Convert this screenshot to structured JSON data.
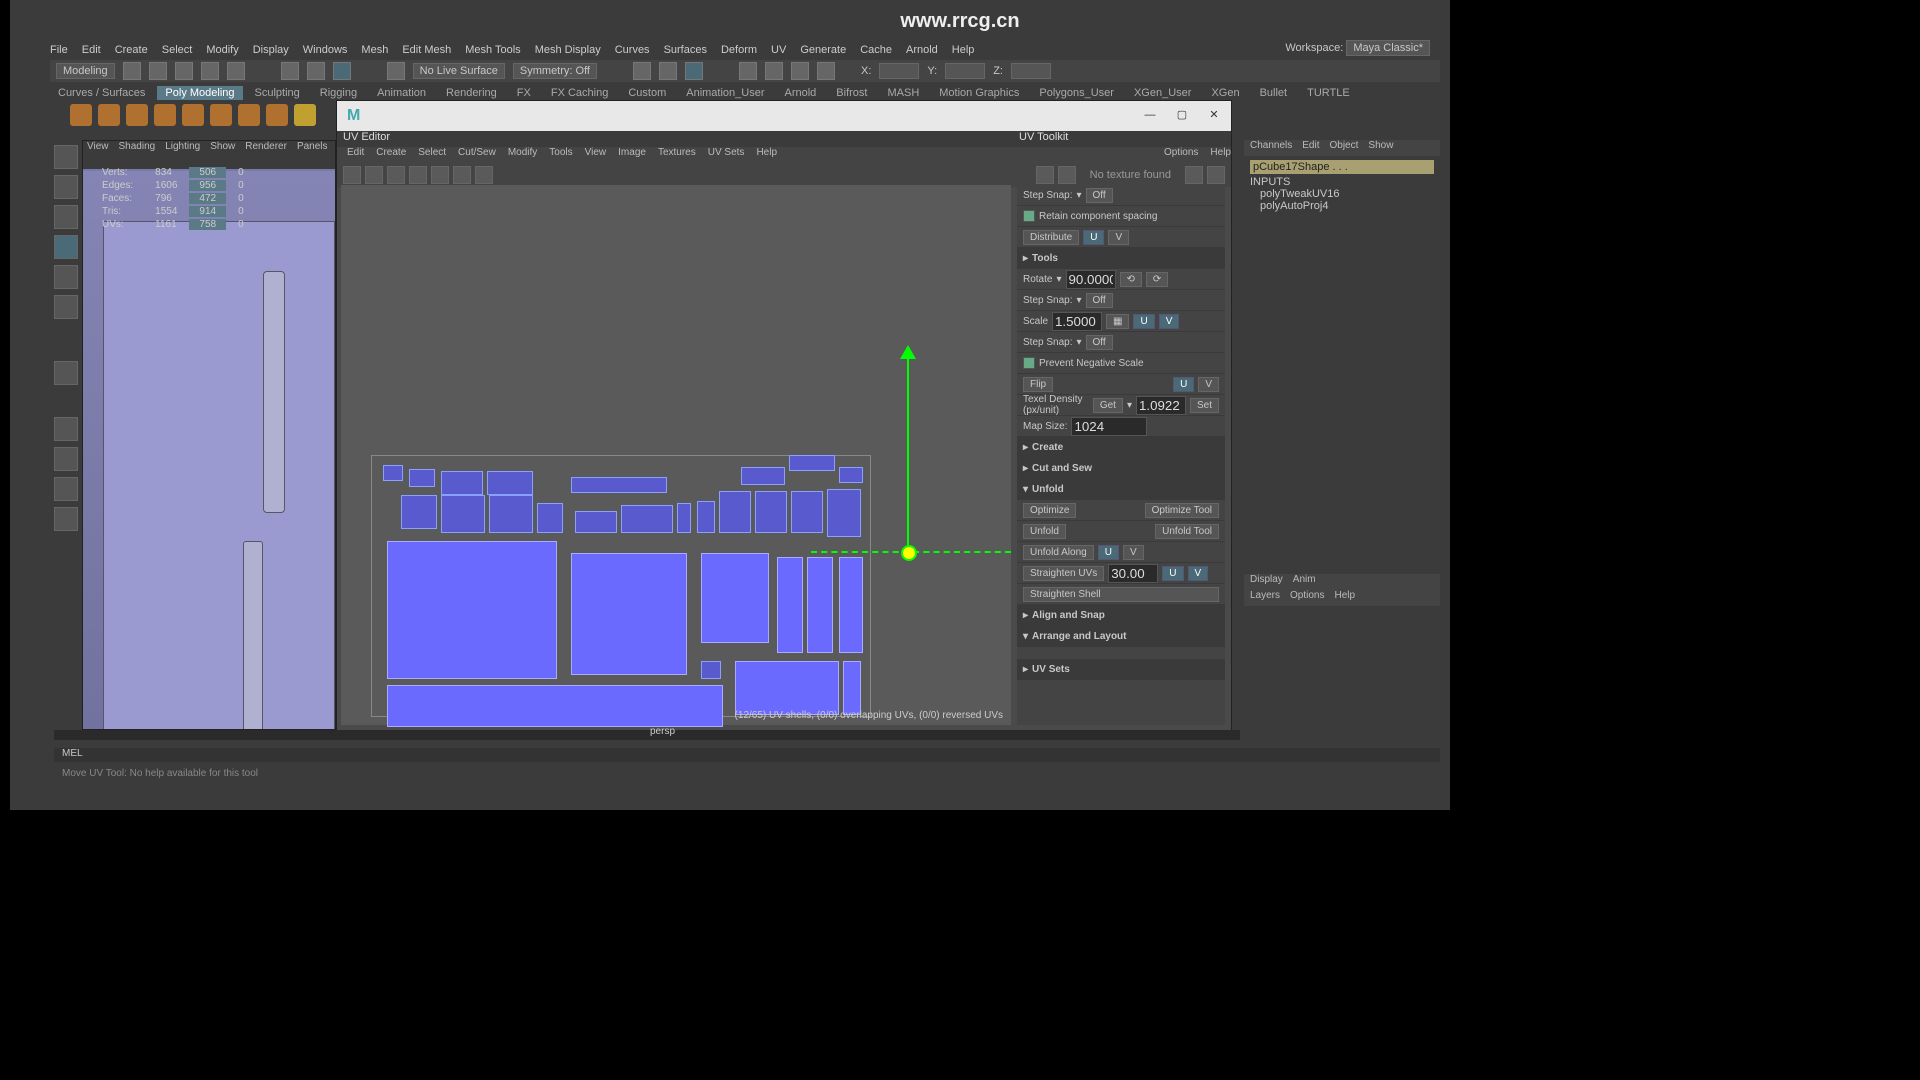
{
  "url": "www.rrcg.cn",
  "workspace_label": "Workspace:",
  "workspace_value": "Maya Classic*",
  "menus": [
    "File",
    "Edit",
    "Create",
    "Select",
    "Modify",
    "Display",
    "Windows",
    "Mesh",
    "Edit Mesh",
    "Mesh Tools",
    "Mesh Display",
    "Curves",
    "Surfaces",
    "Deform",
    "UV",
    "Generate",
    "Cache",
    "Arnold",
    "Help"
  ],
  "mode": "Modeling",
  "live_surface": "No Live Surface",
  "symmetry": "Symmetry: Off",
  "axes": {
    "x": "X:",
    "y": "Y:",
    "z": "Z:"
  },
  "shelves": [
    "Curves / Surfaces",
    "Poly Modeling",
    "Sculpting",
    "Rigging",
    "Animation",
    "Rendering",
    "FX",
    "FX Caching",
    "Custom",
    "Animation_User",
    "Arnold",
    "Bifrost",
    "MASH",
    "Motion Graphics",
    "Polygons_User",
    "XGen_User",
    "XGen",
    "Bullet",
    "TURTLE"
  ],
  "active_shelf": "Poly Modeling",
  "vp_menus": [
    "View",
    "Shading",
    "Lighting",
    "Show",
    "Renderer",
    "Panels"
  ],
  "hud": {
    "rows": [
      "Verts:",
      "Edges:",
      "Faces:",
      "Tris:",
      "UVs:"
    ],
    "c1": [
      "834",
      "1606",
      "796",
      "1554",
      "1161"
    ],
    "c2": [
      "506",
      "956",
      "472",
      "914",
      "758"
    ],
    "c3": [
      "0",
      "0",
      "0",
      "0",
      "0"
    ]
  },
  "uv": {
    "title_l": "UV Editor",
    "title_r": "UV Toolkit",
    "menus": [
      "Edit",
      "Create",
      "Select",
      "Cut/Sew",
      "Modify",
      "Tools",
      "View",
      "Image",
      "Textures",
      "UV Sets",
      "Help"
    ],
    "tk_menus": [
      "Options",
      "Help"
    ],
    "no_tex": "No texture found",
    "status": "(12/65) UV shells, (0/0) overlapping UVs, (0/0) reversed UVs"
  },
  "tk": {
    "step_snap": "Step Snap:",
    "off": "Off",
    "retain": "Retain component spacing",
    "distribute": "Distribute",
    "u": "U",
    "v": "V",
    "tools": "Tools",
    "rotate": "Rotate",
    "rotate_val": "90.0000",
    "scale": "Scale",
    "scale_val": "1.5000",
    "prevent": "Prevent Negative Scale",
    "flip": "Flip",
    "texel": "Texel Density (px/unit)",
    "get": "Get",
    "set": "Set",
    "td_val": "1.0922",
    "mapsize": "Map Size:",
    "mapsize_val": "1024",
    "create": "Create",
    "cutsew": "Cut and Sew",
    "unfold": "Unfold",
    "optimize": "Optimize",
    "optimize_tool": "Optimize Tool",
    "unfold_btn": "Unfold",
    "unfold_tool": "Unfold Tool",
    "unfold_along": "Unfold Along",
    "straighten": "Straighten UVs",
    "straighten_val": "30.00",
    "straighten_shell": "Straighten Shell",
    "align": "Align and Snap",
    "arrange": "Arrange and Layout",
    "uvsets": "UV Sets"
  },
  "ch": {
    "tabs": [
      "Channels",
      "Edit",
      "Object",
      "Show"
    ],
    "node": "pCube17Shape . . .",
    "inputs": "INPUTS",
    "in1": "polyTweakUV16",
    "in2": "polyAutoProj4",
    "disp_tabs": [
      "Display",
      "Anim"
    ],
    "layer_tabs": [
      "Layers",
      "Options",
      "Help"
    ]
  },
  "persp": "persp",
  "mel": "MEL",
  "helpline": "Move UV Tool: No help available for this tool"
}
